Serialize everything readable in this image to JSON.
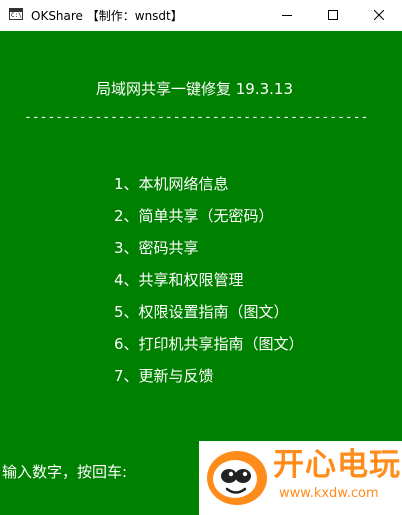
{
  "window": {
    "app_icon_text": "C:\\",
    "title": "OKShare  【制作：wnsdt】"
  },
  "console": {
    "heading": "局域网共享一键修复 19.3.13",
    "divider": "--------------------------------------------",
    "menu": [
      "1、本机网络信息",
      "2、简单共享（无密码）",
      "3、密码共享",
      "4、共享和权限管理",
      "5、权限设置指南（图文）",
      "6、打印机共享指南（图文）",
      "7、更新与反馈"
    ],
    "prompt": "输入数字，按回车:"
  },
  "watermark": {
    "brand": "开心电玩",
    "url": "www.kxdw.com"
  },
  "colors": {
    "console_bg": "#008000",
    "console_text": "#ffffff",
    "watermark_orange": "#ff8c1a"
  }
}
